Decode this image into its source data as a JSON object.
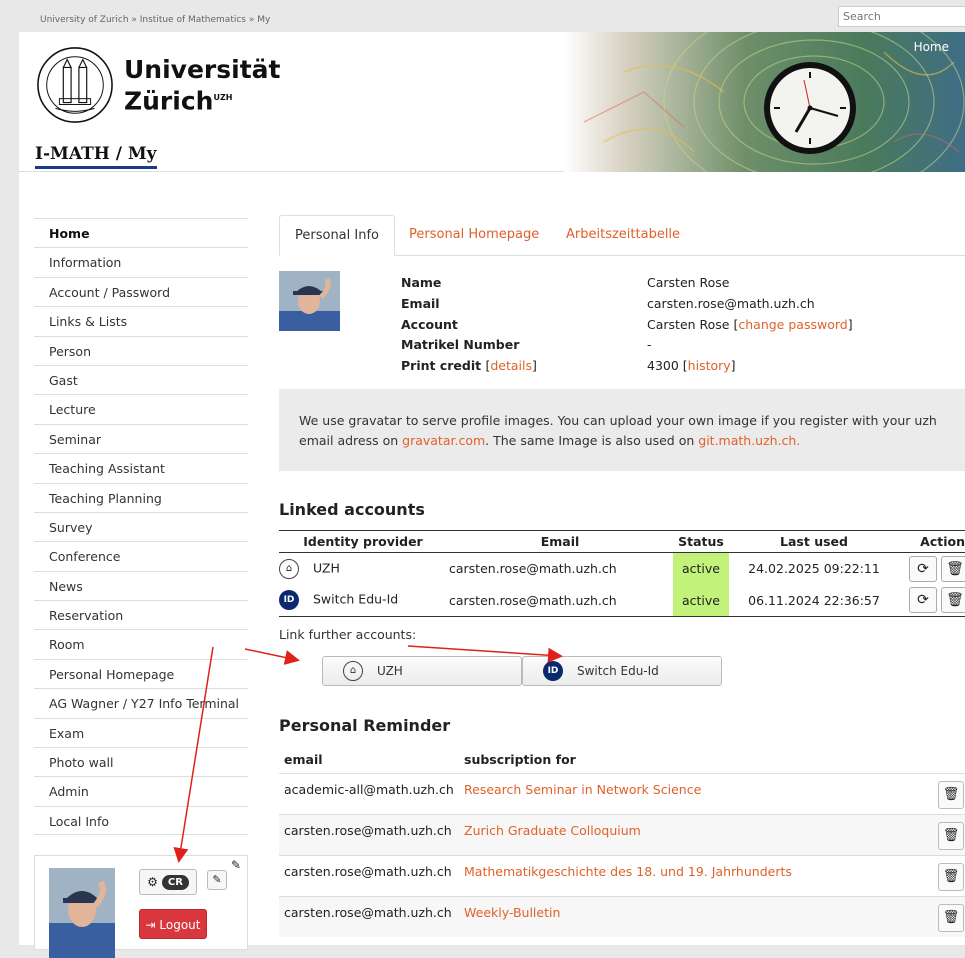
{
  "topbar": {
    "breadcrumb": "University of Zurich » Institue of Mathematics » My",
    "search_placeholder": "Search"
  },
  "header": {
    "uni_line1": "Universität",
    "uni_line2": "Zürich",
    "uni_sup": "UZH",
    "site_title": "I-MATH / My",
    "home_link": "Home"
  },
  "sidebar": {
    "items": [
      {
        "label": "Home",
        "active": true
      },
      {
        "label": "Information"
      },
      {
        "label": "Account / Password"
      },
      {
        "label": "Links & Lists"
      },
      {
        "label": "Person"
      },
      {
        "label": "Gast"
      },
      {
        "label": "Lecture"
      },
      {
        "label": "Seminar"
      },
      {
        "label": "Teaching Assistant"
      },
      {
        "label": "Teaching Planning"
      },
      {
        "label": "Survey"
      },
      {
        "label": "Conference"
      },
      {
        "label": "News"
      },
      {
        "label": "Reservation"
      },
      {
        "label": "Room"
      },
      {
        "label": "Personal Homepage"
      },
      {
        "label": "AG Wagner / Y27 Info Terminal"
      },
      {
        "label": "Exam"
      },
      {
        "label": "Photo wall"
      },
      {
        "label": "Admin"
      },
      {
        "label": "Local Info"
      }
    ],
    "userbox": {
      "initials": "CR",
      "logout": "Logout"
    }
  },
  "tabs": [
    {
      "label": "Personal Info",
      "active": true
    },
    {
      "label": "Personal Homepage"
    },
    {
      "label": "Arbeitszeittabelle"
    }
  ],
  "info": {
    "labels": [
      "Name",
      "Email",
      "Account",
      "Matrikel Number",
      "Print credit"
    ],
    "name": "Carsten Rose",
    "email": "carsten.rose@math.uzh.ch",
    "account": "Carsten Rose",
    "change_password": "change password",
    "matrikel": "-",
    "print_credit_details": "details",
    "print_credit_value": "4300",
    "print_credit_history": "history"
  },
  "notice": {
    "text1": "We use gravatar to serve profile images. You can upload your own image if you register with your uzh email adress on ",
    "link1": "gravatar.com",
    "text2": ". The same Image is also used on ",
    "link2": "git.math.uzh.ch."
  },
  "linked_accounts": {
    "title": "Linked accounts",
    "headers": [
      "Identity provider",
      "Email",
      "Status",
      "Last used",
      "Action"
    ],
    "rows": [
      {
        "provider": "UZH",
        "email": "carsten.rose@math.uzh.ch",
        "status": "active",
        "last_used": "24.02.2025 09:22:11"
      },
      {
        "provider": "Switch Edu-Id",
        "email": "carsten.rose@math.uzh.ch",
        "status": "active",
        "last_used": "06.11.2024 22:36:57"
      }
    ],
    "link_further": "Link further accounts:",
    "buttons": [
      "UZH",
      "Switch Edu-Id"
    ]
  },
  "reminder": {
    "title": "Personal Reminder",
    "headers": [
      "email",
      "subscription for"
    ],
    "rows": [
      {
        "email": "academic-all@math.uzh.ch",
        "subscription": "Research Seminar in Network Science"
      },
      {
        "email": "carsten.rose@math.uzh.ch",
        "subscription": "Zurich Graduate Colloquium"
      },
      {
        "email": "carsten.rose@math.uzh.ch",
        "subscription": "Mathematikgeschichte des 18. und 19. Jahrhunderts"
      },
      {
        "email": "carsten.rose@math.uzh.ch",
        "subscription": "Weekly-Bulletin"
      }
    ]
  },
  "colors": {
    "accent": "#e0612a",
    "active_status": "#c3f27a",
    "logout": "#d9363e",
    "site_title_underline": "#1b3a8c",
    "annotation_arrow": "#e0201b"
  }
}
